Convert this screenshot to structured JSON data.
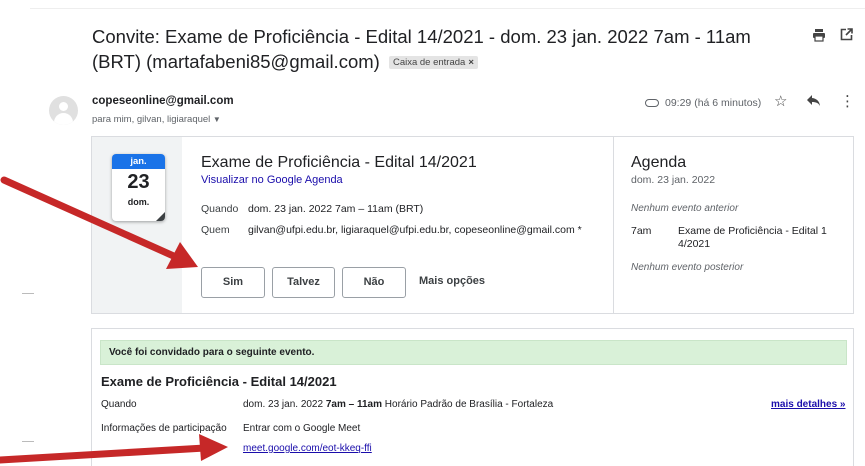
{
  "email": {
    "subject": "Convite: Exame de Proficiência - Edital 14/2021 - dom. 23 jan. 2022 7am - 11am (BRT) (martafabeni85@gmail.com)",
    "label_chip": "Caixa de entrada",
    "sender": "copeseonline@gmail.com",
    "recipients": "para mim, gilvan, ligiaraquel",
    "time": "09:29 (há 6 minutos)"
  },
  "icons": {
    "print": "print-icon",
    "open_new_window": "open-in-new-window-icon",
    "label": "label-icon",
    "star": "star-icon",
    "reply": "reply-icon",
    "more": "more-vert-icon",
    "dropdown": "chevron-down-icon",
    "chip_close": "close-icon"
  },
  "calendar_card": {
    "month": "jan.",
    "day": "23",
    "weekday": "dom.",
    "title": "Exame de Proficiência - Edital 14/2021",
    "view_link": "Visualizar no Google Agenda",
    "when_label": "Quando",
    "when_value": "dom. 23 jan. 2022 7am – 11am (BRT)",
    "who_label": "Quem",
    "who_value": "gilvan@ufpi.edu.br, ligiaraquel@ufpi.edu.br, copeseonline@gmail.com *",
    "rsvp": {
      "yes": "Sim",
      "maybe": "Talvez",
      "no": "Não",
      "more": "Mais opções"
    }
  },
  "agenda": {
    "title": "Agenda",
    "date": "dom. 23 jan. 2022",
    "no_previous": "Nenhum evento anterior",
    "event_time": "7am",
    "event_title": "Exame de Proficiência - Edital 1 4/2021",
    "no_next": "Nenhum evento posterior"
  },
  "invite": {
    "banner": "Você foi convidado para o seguinte evento.",
    "title": "Exame de Proficiência - Edital 14/2021",
    "when_label": "Quando",
    "when_value_date": "dom. 23 jan. 2022",
    "when_value_time": "7am – 11am",
    "when_value_tz": "Horário Padrão de Brasília - Fortaleza",
    "more_details": "mais detalhes »",
    "join_label": "Informações de participação",
    "join_value": "Entrar com o Google Meet",
    "meet_link": "meet.google.com/eot-kkeq-ffi"
  },
  "colors": {
    "accent_blue": "#1a73e8",
    "link": "#1a0dab",
    "banner_green": "#d9f1d8",
    "arrow_red": "#c62828"
  }
}
